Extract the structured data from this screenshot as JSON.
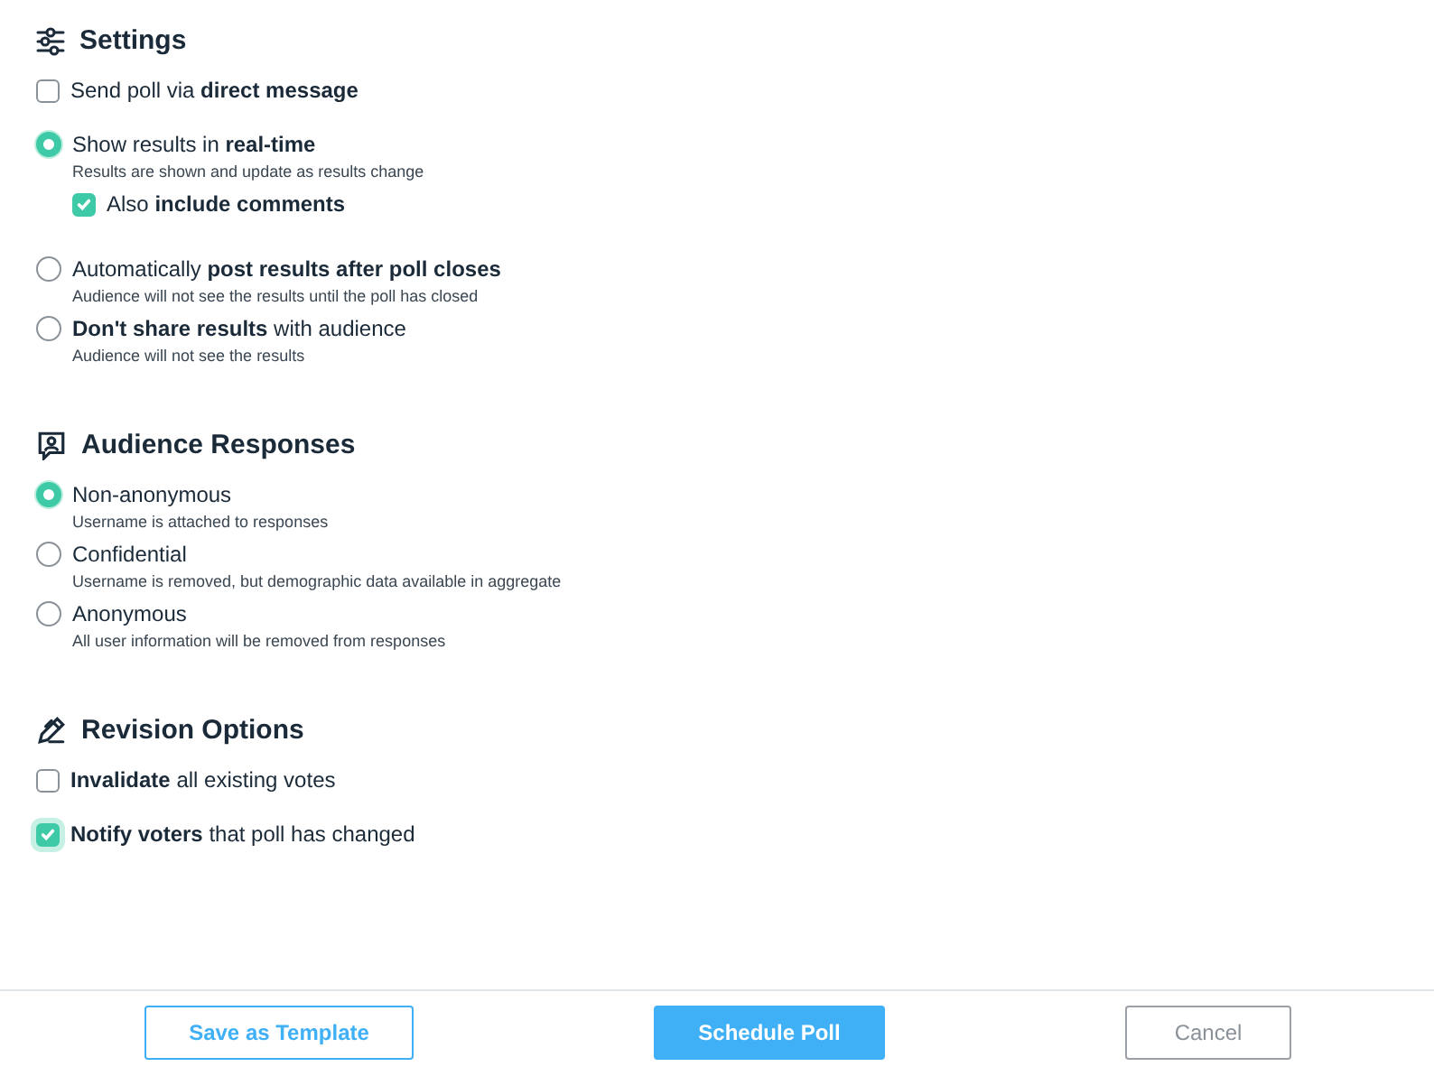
{
  "sections": [
    {
      "title": "Settings",
      "options": [
        {
          "kind": "checkbox",
          "label": "Send poll via **direct message**",
          "checked": false
        },
        {
          "kind": "radio",
          "label": "Show results in **real-time**",
          "description": "Results are shown and update as results change",
          "selected": true,
          "children": [
            {
              "kind": "checkbox",
              "label": "Also **include comments**",
              "checked": true
            }
          ]
        },
        {
          "kind": "radio",
          "label": "Automatically **post results after poll closes**",
          "description": "Audience will not see the results until the poll has closed",
          "selected": false
        },
        {
          "kind": "radio",
          "label": "**Don't share results** with audience",
          "description": "Audience will not see the results",
          "selected": false
        }
      ]
    },
    {
      "title": "Audience Responses",
      "options": [
        {
          "kind": "radio",
          "label": "Non-anonymous",
          "description": "Username is attached to responses",
          "selected": true
        },
        {
          "kind": "radio",
          "label": "Confidential",
          "description": "Username is removed, but demographic data available in aggregate",
          "selected": false
        },
        {
          "kind": "radio",
          "label": "Anonymous",
          "description": "All user information will be removed from responses",
          "selected": false
        }
      ]
    },
    {
      "title": "Revision Options",
      "options": [
        {
          "kind": "checkbox",
          "label": "**Invalidate** all existing votes",
          "checked": false
        },
        {
          "kind": "checkbox",
          "label": "**Notify voters** that poll has changed",
          "checked": true,
          "focused": true
        }
      ]
    }
  ],
  "buttons": [
    {
      "kind": "outline",
      "label": "Save as Template"
    },
    {
      "kind": "primary",
      "label": "Schedule Poll"
    },
    {
      "kind": "plain",
      "label": "Cancel"
    }
  ]
}
